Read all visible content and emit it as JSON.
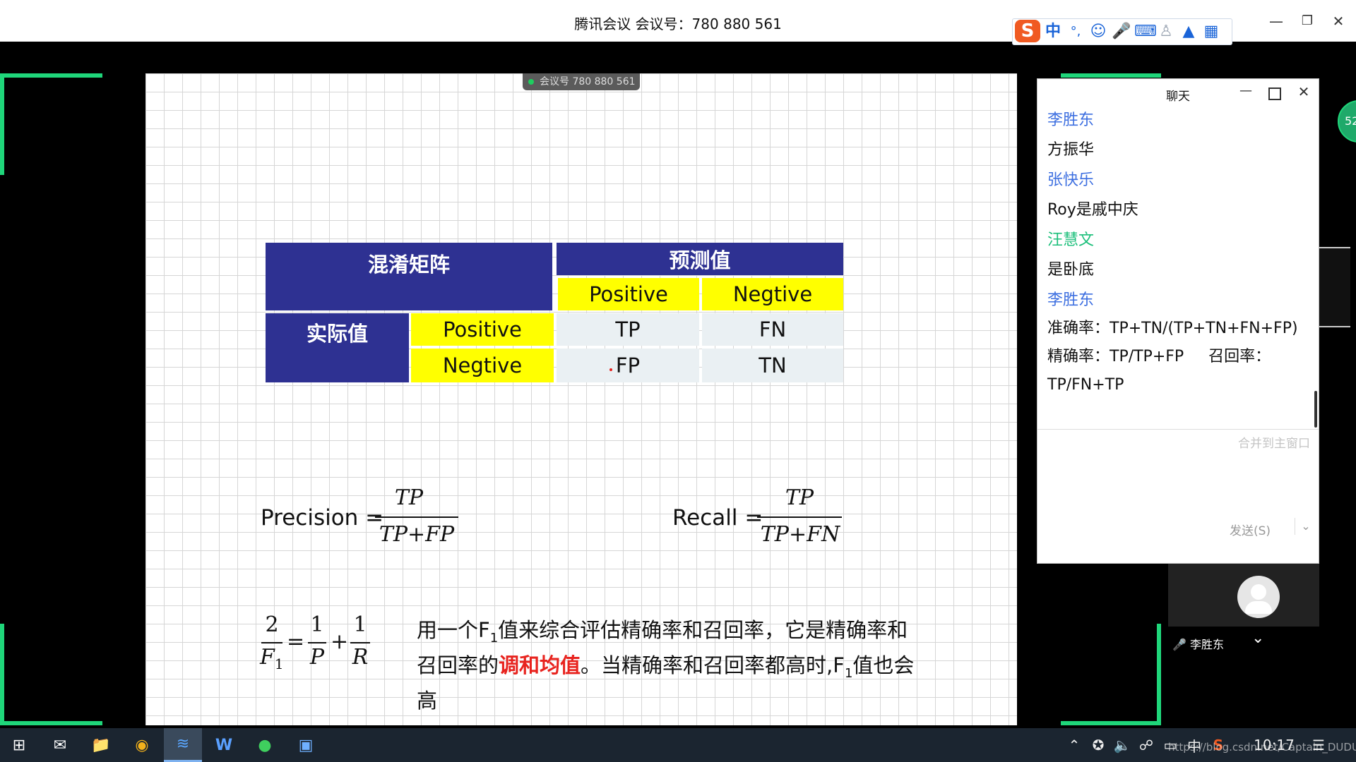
{
  "window": {
    "title": "腾讯会议 会议号：780 880 561"
  },
  "meeting_badge": "会议号 780 880 561",
  "ime": {
    "lang": "中",
    "punct": "°,"
  },
  "slide": {
    "table": {
      "corner": "混淆矩阵",
      "pred_header": "预测值",
      "actual_header": "实际值",
      "pred_pos": "Positive",
      "pred_neg": "Negtive",
      "act_pos": "Positive",
      "act_neg": "Negtive",
      "tp": "TP",
      "fn": "FN",
      "fp": "FP",
      "tn": "TN"
    },
    "precision": {
      "label": "Precision =",
      "num": "TP",
      "den": "TP+FP"
    },
    "recall": {
      "label": "Recall =",
      "num": "TP",
      "den": "TP+FN"
    },
    "f1": {
      "lhs_num": "2",
      "lhs_den": "F",
      "lhs_sub": "1",
      "eq": "=",
      "p_num": "1",
      "p_den": "P",
      "plus": "+",
      "r_num": "1",
      "r_den": "R"
    },
    "text": {
      "l1a": "用一个F",
      "sub": "1",
      "l1b": "值来综合评估精确率和召回率，它是精确率和",
      "l2a": "召回率的",
      "l2red": "调和均值",
      "l2b": "。当精确率和召回率都高时,F",
      "l2c": "值也会",
      "l3": "高"
    }
  },
  "chat": {
    "title": "聊天",
    "messages": [
      {
        "name": "李胜东",
        "color": "blue",
        "lines": [
          "方振华"
        ]
      },
      {
        "name": "张快乐",
        "color": "blue",
        "lines": [
          "Roy是戚中庆"
        ]
      },
      {
        "name": "汪慧文",
        "color": "teal",
        "lines": [
          "是卧底"
        ]
      },
      {
        "name": "李胜东",
        "color": "blue",
        "lines": [
          "准确率：TP+TN/(TP+TN+FN+FP)",
          "精确率：TP/TP+FP     召回率：",
          "TP/FN+TP"
        ]
      }
    ],
    "merge_label": "合并到主窗口",
    "send_label": "发送(S)"
  },
  "participant": {
    "name": "李胜东",
    "badge": "52"
  },
  "taskbar": {
    "ime": "中",
    "time": "10:17",
    "watermark": "https://blog.csdn.net/Captain_DUDU"
  }
}
